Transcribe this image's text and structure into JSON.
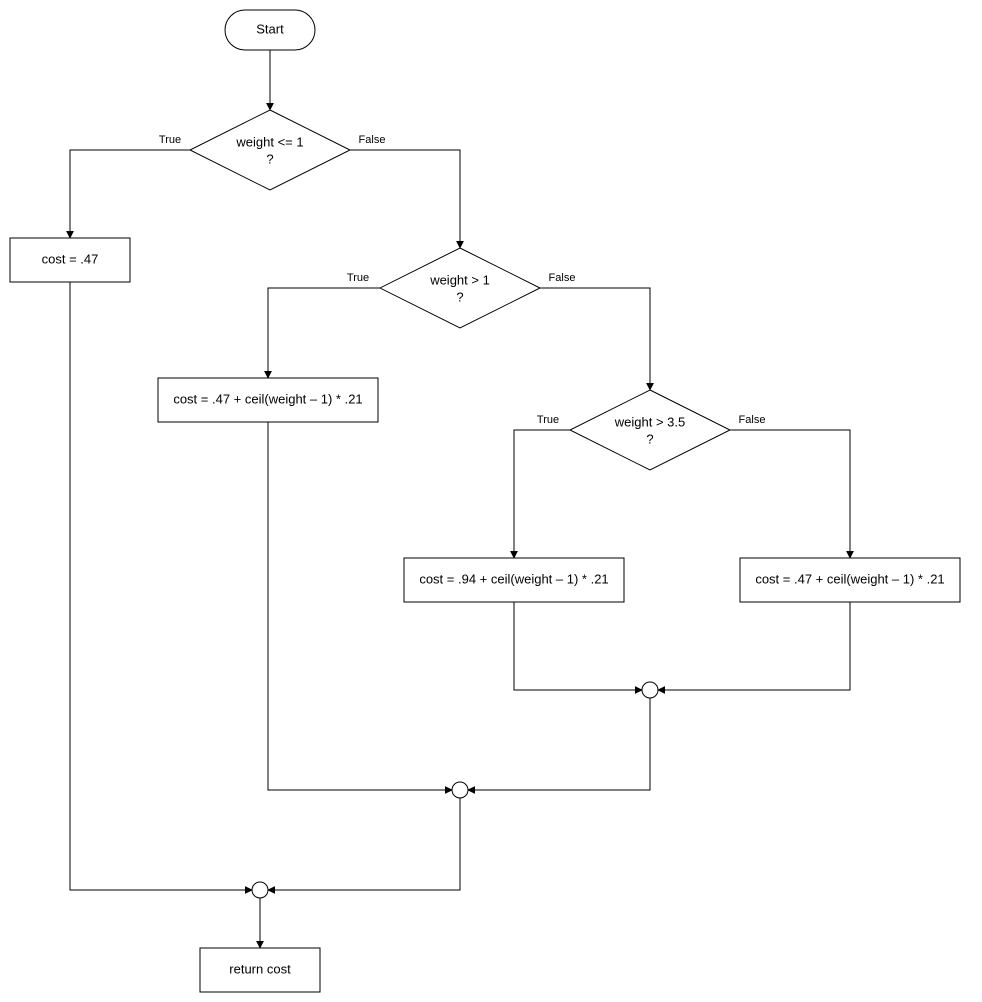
{
  "flowchart": {
    "nodes": {
      "start": {
        "label": "Start"
      },
      "decision1": {
        "line1": "weight <= 1",
        "line2": "?"
      },
      "process1": {
        "label": "cost = .47"
      },
      "decision2": {
        "line1": "weight > 1",
        "line2": "?"
      },
      "process2": {
        "label": "cost = .47 + ceil(weight – 1) * .21"
      },
      "decision3": {
        "line1": "weight > 3.5",
        "line2": "?"
      },
      "process3": {
        "label": "cost = .94 + ceil(weight – 1) * .21"
      },
      "process4": {
        "label": "cost = .47 + ceil(weight – 1) * .21"
      },
      "return": {
        "label": "return cost"
      }
    },
    "edgeLabels": {
      "true": "True",
      "false": "False"
    }
  }
}
